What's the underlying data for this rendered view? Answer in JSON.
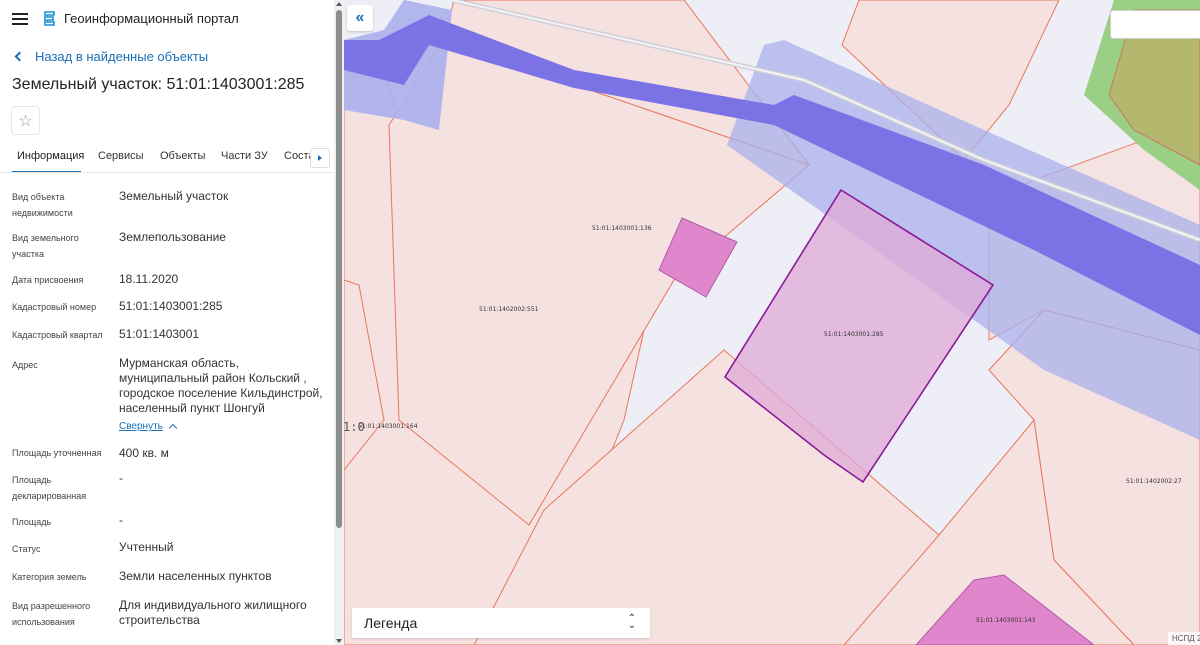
{
  "header": {
    "app_title": "Геоинформационный портал"
  },
  "nav": {
    "back_label": "Назад в найденные объекты"
  },
  "object": {
    "title": "Земельный участок: 51:01:1403001:285",
    "favorite_icon": "☆"
  },
  "tabs": [
    {
      "label": "Информация"
    },
    {
      "label": "Сервисы"
    },
    {
      "label": "Объекты"
    },
    {
      "label": "Части ЗУ"
    },
    {
      "label": "Соста"
    }
  ],
  "properties": [
    {
      "label": "Вид объекта недвижимости",
      "value": "Земельный участок"
    },
    {
      "label": "Вид земельного участка",
      "value": "Землепользование"
    },
    {
      "label": "Дата присвоения",
      "value": "18.11.2020"
    },
    {
      "label": "Кадастровый номер",
      "value": "51:01:1403001:285"
    },
    {
      "label": "Кадастровый квартал",
      "value": "51:01:1403001"
    },
    {
      "label": "Адрес",
      "value": "Мурманская область, муниципальный район Кольский , городское поселение Кильдинстрой, населенный пункт Шонгуй"
    },
    {
      "label": "Площадь уточненная",
      "value": "400 кв. м"
    },
    {
      "label": "Площадь декларированная",
      "value": "-"
    },
    {
      "label": "Площадь",
      "value": "-"
    },
    {
      "label": "Статус",
      "value": "Учтенный"
    },
    {
      "label": "Категория земель",
      "value": "Земли населенных пунктов"
    },
    {
      "label": "Вид разрешенного использования",
      "value": "Для индивидуального жилищного строительства"
    }
  ],
  "address_collapse_label": "Свернуть",
  "map": {
    "collapse_icon": "«",
    "legend_label": "Легенда",
    "legend_toggle": "⌃⌄",
    "attribution": "НСПД 2",
    "scale_fragment": "1:0",
    "parcel_labels": {
      "p136": "51:01:1403001:136",
      "p551": "51:01:1402002:551",
      "p285": "51:01:1403001:285",
      "p164": "51:01:1403001:164",
      "p27": "51:01:1402002:27",
      "p143": "51:01:1403001:143"
    }
  },
  "colors": {
    "accent": "#1a6fb6",
    "parcel_fill": "#f6e1e1",
    "parcel_stroke": "#e8775a",
    "selected_fill": "#e4b8dc",
    "selected_stroke": "#8a1a9a",
    "road_dark": "#7b72e6",
    "road_light": "#aab0ec",
    "green": "#9ccf86"
  }
}
